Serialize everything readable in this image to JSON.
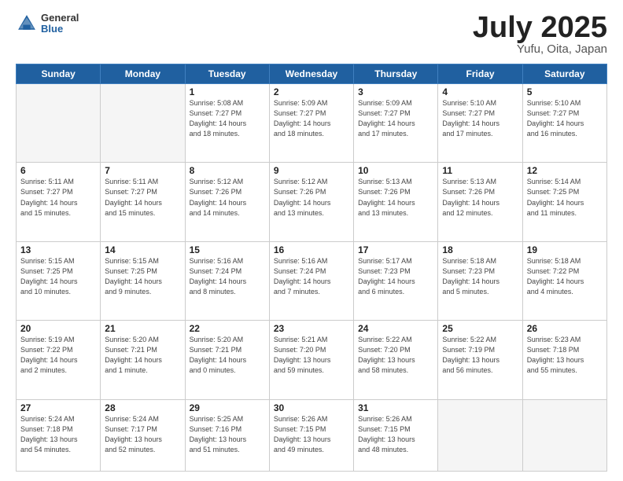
{
  "header": {
    "logo_general": "General",
    "logo_blue": "Blue",
    "title": "July 2025",
    "location": "Yufu, Oita, Japan"
  },
  "days_of_week": [
    "Sunday",
    "Monday",
    "Tuesday",
    "Wednesday",
    "Thursday",
    "Friday",
    "Saturday"
  ],
  "weeks": [
    [
      {
        "day": "",
        "info": ""
      },
      {
        "day": "",
        "info": ""
      },
      {
        "day": "1",
        "info": "Sunrise: 5:08 AM\nSunset: 7:27 PM\nDaylight: 14 hours\nand 18 minutes."
      },
      {
        "day": "2",
        "info": "Sunrise: 5:09 AM\nSunset: 7:27 PM\nDaylight: 14 hours\nand 18 minutes."
      },
      {
        "day": "3",
        "info": "Sunrise: 5:09 AM\nSunset: 7:27 PM\nDaylight: 14 hours\nand 17 minutes."
      },
      {
        "day": "4",
        "info": "Sunrise: 5:10 AM\nSunset: 7:27 PM\nDaylight: 14 hours\nand 17 minutes."
      },
      {
        "day": "5",
        "info": "Sunrise: 5:10 AM\nSunset: 7:27 PM\nDaylight: 14 hours\nand 16 minutes."
      }
    ],
    [
      {
        "day": "6",
        "info": "Sunrise: 5:11 AM\nSunset: 7:27 PM\nDaylight: 14 hours\nand 15 minutes."
      },
      {
        "day": "7",
        "info": "Sunrise: 5:11 AM\nSunset: 7:27 PM\nDaylight: 14 hours\nand 15 minutes."
      },
      {
        "day": "8",
        "info": "Sunrise: 5:12 AM\nSunset: 7:26 PM\nDaylight: 14 hours\nand 14 minutes."
      },
      {
        "day": "9",
        "info": "Sunrise: 5:12 AM\nSunset: 7:26 PM\nDaylight: 14 hours\nand 13 minutes."
      },
      {
        "day": "10",
        "info": "Sunrise: 5:13 AM\nSunset: 7:26 PM\nDaylight: 14 hours\nand 13 minutes."
      },
      {
        "day": "11",
        "info": "Sunrise: 5:13 AM\nSunset: 7:26 PM\nDaylight: 14 hours\nand 12 minutes."
      },
      {
        "day": "12",
        "info": "Sunrise: 5:14 AM\nSunset: 7:25 PM\nDaylight: 14 hours\nand 11 minutes."
      }
    ],
    [
      {
        "day": "13",
        "info": "Sunrise: 5:15 AM\nSunset: 7:25 PM\nDaylight: 14 hours\nand 10 minutes."
      },
      {
        "day": "14",
        "info": "Sunrise: 5:15 AM\nSunset: 7:25 PM\nDaylight: 14 hours\nand 9 minutes."
      },
      {
        "day": "15",
        "info": "Sunrise: 5:16 AM\nSunset: 7:24 PM\nDaylight: 14 hours\nand 8 minutes."
      },
      {
        "day": "16",
        "info": "Sunrise: 5:16 AM\nSunset: 7:24 PM\nDaylight: 14 hours\nand 7 minutes."
      },
      {
        "day": "17",
        "info": "Sunrise: 5:17 AM\nSunset: 7:23 PM\nDaylight: 14 hours\nand 6 minutes."
      },
      {
        "day": "18",
        "info": "Sunrise: 5:18 AM\nSunset: 7:23 PM\nDaylight: 14 hours\nand 5 minutes."
      },
      {
        "day": "19",
        "info": "Sunrise: 5:18 AM\nSunset: 7:22 PM\nDaylight: 14 hours\nand 4 minutes."
      }
    ],
    [
      {
        "day": "20",
        "info": "Sunrise: 5:19 AM\nSunset: 7:22 PM\nDaylight: 14 hours\nand 2 minutes."
      },
      {
        "day": "21",
        "info": "Sunrise: 5:20 AM\nSunset: 7:21 PM\nDaylight: 14 hours\nand 1 minute."
      },
      {
        "day": "22",
        "info": "Sunrise: 5:20 AM\nSunset: 7:21 PM\nDaylight: 14 hours\nand 0 minutes."
      },
      {
        "day": "23",
        "info": "Sunrise: 5:21 AM\nSunset: 7:20 PM\nDaylight: 13 hours\nand 59 minutes."
      },
      {
        "day": "24",
        "info": "Sunrise: 5:22 AM\nSunset: 7:20 PM\nDaylight: 13 hours\nand 58 minutes."
      },
      {
        "day": "25",
        "info": "Sunrise: 5:22 AM\nSunset: 7:19 PM\nDaylight: 13 hours\nand 56 minutes."
      },
      {
        "day": "26",
        "info": "Sunrise: 5:23 AM\nSunset: 7:18 PM\nDaylight: 13 hours\nand 55 minutes."
      }
    ],
    [
      {
        "day": "27",
        "info": "Sunrise: 5:24 AM\nSunset: 7:18 PM\nDaylight: 13 hours\nand 54 minutes."
      },
      {
        "day": "28",
        "info": "Sunrise: 5:24 AM\nSunset: 7:17 PM\nDaylight: 13 hours\nand 52 minutes."
      },
      {
        "day": "29",
        "info": "Sunrise: 5:25 AM\nSunset: 7:16 PM\nDaylight: 13 hours\nand 51 minutes."
      },
      {
        "day": "30",
        "info": "Sunrise: 5:26 AM\nSunset: 7:15 PM\nDaylight: 13 hours\nand 49 minutes."
      },
      {
        "day": "31",
        "info": "Sunrise: 5:26 AM\nSunset: 7:15 PM\nDaylight: 13 hours\nand 48 minutes."
      },
      {
        "day": "",
        "info": ""
      },
      {
        "day": "",
        "info": ""
      }
    ]
  ]
}
